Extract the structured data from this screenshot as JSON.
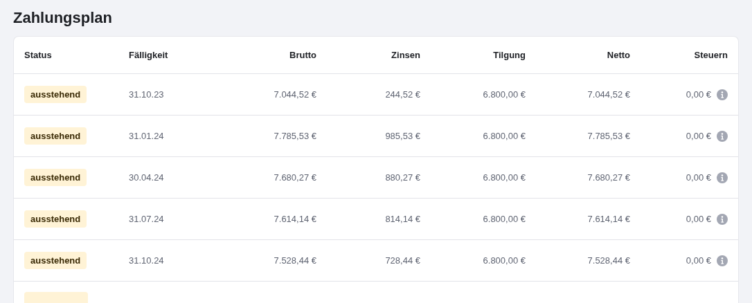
{
  "title": "Zahlungsplan",
  "table": {
    "columns": [
      "Status",
      "Fälligkeit",
      "Brutto",
      "Zinsen",
      "Tilgung",
      "Netto",
      "Steuern"
    ],
    "rows": [
      {
        "status": "ausstehend",
        "due": "31.10.23",
        "gross": "7.044,52 €",
        "interest": "244,52 €",
        "repayment": "6.800,00 €",
        "net": "7.044,52 €",
        "tax": "0,00 €"
      },
      {
        "status": "ausstehend",
        "due": "31.01.24",
        "gross": "7.785,53 €",
        "interest": "985,53 €",
        "repayment": "6.800,00 €",
        "net": "7.785,53 €",
        "tax": "0,00 €"
      },
      {
        "status": "ausstehend",
        "due": "30.04.24",
        "gross": "7.680,27 €",
        "interest": "880,27 €",
        "repayment": "6.800,00 €",
        "net": "7.680,27 €",
        "tax": "0,00 €"
      },
      {
        "status": "ausstehend",
        "due": "31.07.24",
        "gross": "7.614,14 €",
        "interest": "814,14 €",
        "repayment": "6.800,00 €",
        "net": "7.614,14 €",
        "tax": "0,00 €"
      },
      {
        "status": "ausstehend",
        "due": "31.10.24",
        "gross": "7.528,44 €",
        "interest": "728,44 €",
        "repayment": "6.800,00 €",
        "net": "7.528,44 €",
        "tax": "0,00 €"
      }
    ]
  }
}
